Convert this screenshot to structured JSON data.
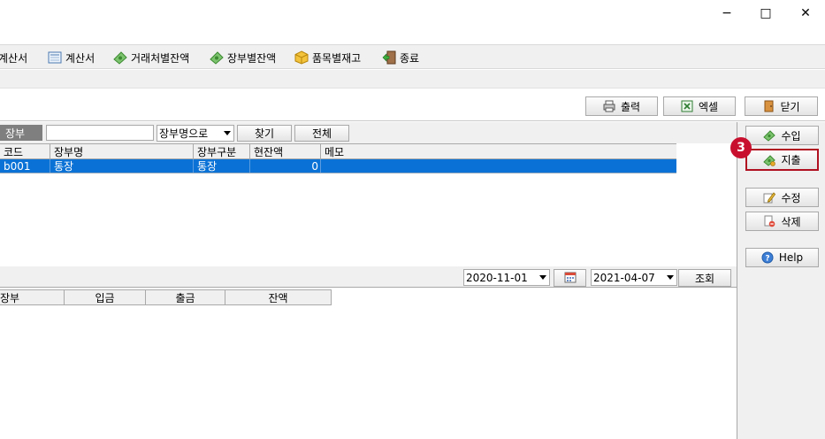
{
  "window": {
    "minimize_glyph": "−",
    "maximize_glyph": "□",
    "close_glyph": "✕"
  },
  "menu": {
    "items": [
      {
        "label": "계산서",
        "icon": "none"
      },
      {
        "label": "계산서",
        "icon": "calculator-icon"
      },
      {
        "label": "거래처별잔액",
        "icon": "money-icon"
      },
      {
        "label": "장부별잔액",
        "icon": "money-icon"
      },
      {
        "label": "품목별재고",
        "icon": "box-icon"
      },
      {
        "label": "종료",
        "icon": "exit-door-icon"
      }
    ]
  },
  "toolbar": {
    "print_label": "출력",
    "excel_label": "엑셀",
    "close_label": "닫기"
  },
  "search": {
    "field_label": "장부",
    "value": "",
    "mode_selected": "장부명으로",
    "find_label": "찾기",
    "all_label": "전체"
  },
  "ledger_grid": {
    "columns": [
      "코드",
      "장부명",
      "장부구분",
      "현잔액",
      "메모"
    ],
    "rows": [
      {
        "code": "b001",
        "name": "통장",
        "type": "통장",
        "balance": "0",
        "memo": ""
      }
    ]
  },
  "date_filter": {
    "from": "2020-11-01",
    "to": "2021-04-07",
    "query_label": "조회"
  },
  "transaction_grid": {
    "columns": [
      "장부",
      "입금",
      "출금",
      "잔액"
    ]
  },
  "side_actions": {
    "income_label": "수입",
    "expense_label": "지출",
    "edit_label": "수정",
    "delete_label": "삭제",
    "help_label": "Help",
    "step_badge": "3"
  },
  "colors": {
    "selection": "#0a72d6",
    "highlight_border": "#b01020",
    "badge": "#c8102e",
    "panel_bg": "#f0f0f0"
  }
}
